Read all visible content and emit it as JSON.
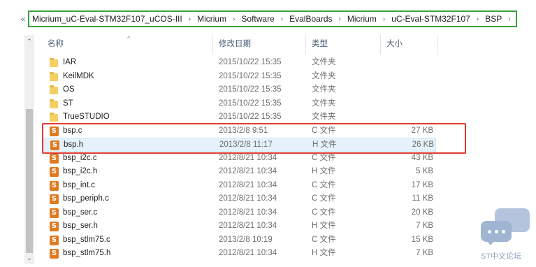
{
  "breadcrumb": {
    "overflow_icon": "«",
    "separator_icon": "›",
    "segments": [
      "Micrium_uC-Eval-STM32F107_uCOS-III",
      "Micrium",
      "Software",
      "EvalBoards",
      "Micrium",
      "uC-Eval-STM32F107",
      "BSP"
    ]
  },
  "columns": {
    "name": "名称",
    "date": "修改日期",
    "type": "类型",
    "size": "大小"
  },
  "scroll_up_icon": "⌃",
  "scroll_down_icon": "⌄",
  "files": [
    {
      "name": "IAR",
      "date": "2015/10/22 15:35",
      "type": "文件夹",
      "size": "",
      "icon": "folder-icon"
    },
    {
      "name": "KeilMDK",
      "date": "2015/10/22 15:35",
      "type": "文件夹",
      "size": "",
      "icon": "folder-icon"
    },
    {
      "name": "OS",
      "date": "2015/10/22 15:35",
      "type": "文件夹",
      "size": "",
      "icon": "folder-icon"
    },
    {
      "name": "ST",
      "date": "2015/10/22 15:35",
      "type": "文件夹",
      "size": "",
      "icon": "folder-icon"
    },
    {
      "name": "TrueSTUDIO",
      "date": "2015/10/22 15:35",
      "type": "文件夹",
      "size": "",
      "icon": "folder-icon"
    },
    {
      "name": "bsp.c",
      "date": "2013/2/8 9:51",
      "type": "C 文件",
      "size": "27 KB",
      "icon": "sublime-file-icon"
    },
    {
      "name": "bsp.h",
      "date": "2013/2/8 11:17",
      "type": "H 文件",
      "size": "26 KB",
      "icon": "sublime-file-icon"
    },
    {
      "name": "bsp_i2c.c",
      "date": "2012/8/21 10:34",
      "type": "C 文件",
      "size": "43 KB",
      "icon": "sublime-file-icon"
    },
    {
      "name": "bsp_i2c.h",
      "date": "2012/8/21 10:34",
      "type": "H 文件",
      "size": "5 KB",
      "icon": "sublime-file-icon"
    },
    {
      "name": "bsp_int.c",
      "date": "2012/8/21 10:34",
      "type": "C 文件",
      "size": "17 KB",
      "icon": "sublime-file-icon"
    },
    {
      "name": "bsp_periph.c",
      "date": "2012/8/21 10:34",
      "type": "C 文件",
      "size": "11 KB",
      "icon": "sublime-file-icon"
    },
    {
      "name": "bsp_ser.c",
      "date": "2012/8/21 10:34",
      "type": "C 文件",
      "size": "20 KB",
      "icon": "sublime-file-icon"
    },
    {
      "name": "bsp_ser.h",
      "date": "2012/8/21 10:34",
      "type": "H 文件",
      "size": "7 KB",
      "icon": "sublime-file-icon"
    },
    {
      "name": "bsp_stlm75.c",
      "date": "2013/2/8 10:19",
      "type": "C 文件",
      "size": "15 KB",
      "icon": "sublime-file-icon"
    },
    {
      "name": "bsp_stlm75.h",
      "date": "2012/8/21 10:34",
      "type": "H 文件",
      "size": "7 KB",
      "icon": "sublime-file-icon"
    }
  ],
  "selected_file": "bsp.h",
  "highlighted_files": [
    "bsp.c",
    "bsp.h"
  ],
  "colors": {
    "highlight_green": "#3aa33a",
    "highlight_red": "#e03c31",
    "selection": "#e5f1fb"
  },
  "watermark": {
    "label": "ST中文论坛"
  }
}
